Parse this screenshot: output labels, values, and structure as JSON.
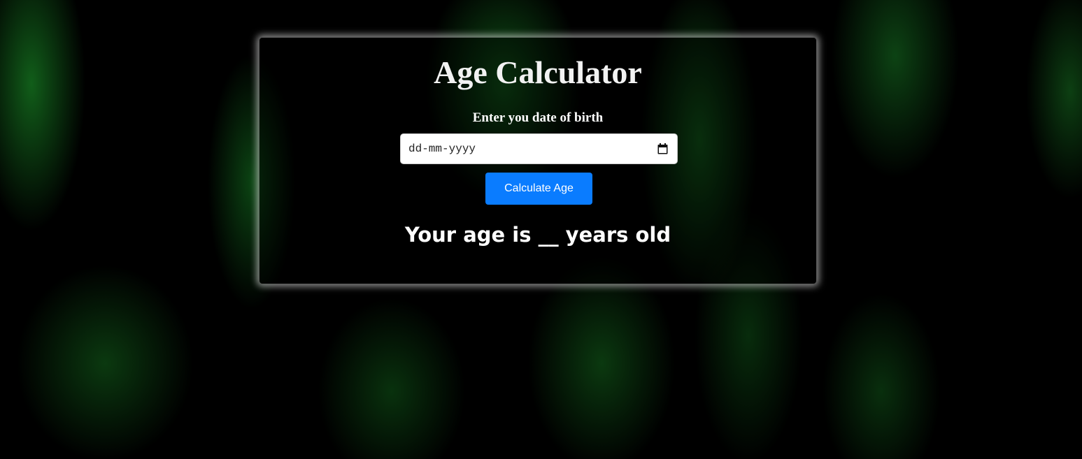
{
  "app": {
    "title": "Age Calculator"
  },
  "form": {
    "dob_label": "Enter you date of birth",
    "date_placeholder": "dd-mm-yyyy",
    "date_value": "",
    "calendar_icon": "calendar-icon",
    "calculate_label": "Calculate Age"
  },
  "result": {
    "text": "Your age is __ years old"
  },
  "colors": {
    "background": "#000000",
    "background_accent": "#146e1e",
    "button": "#0a7cff",
    "text": "#ffffff"
  }
}
